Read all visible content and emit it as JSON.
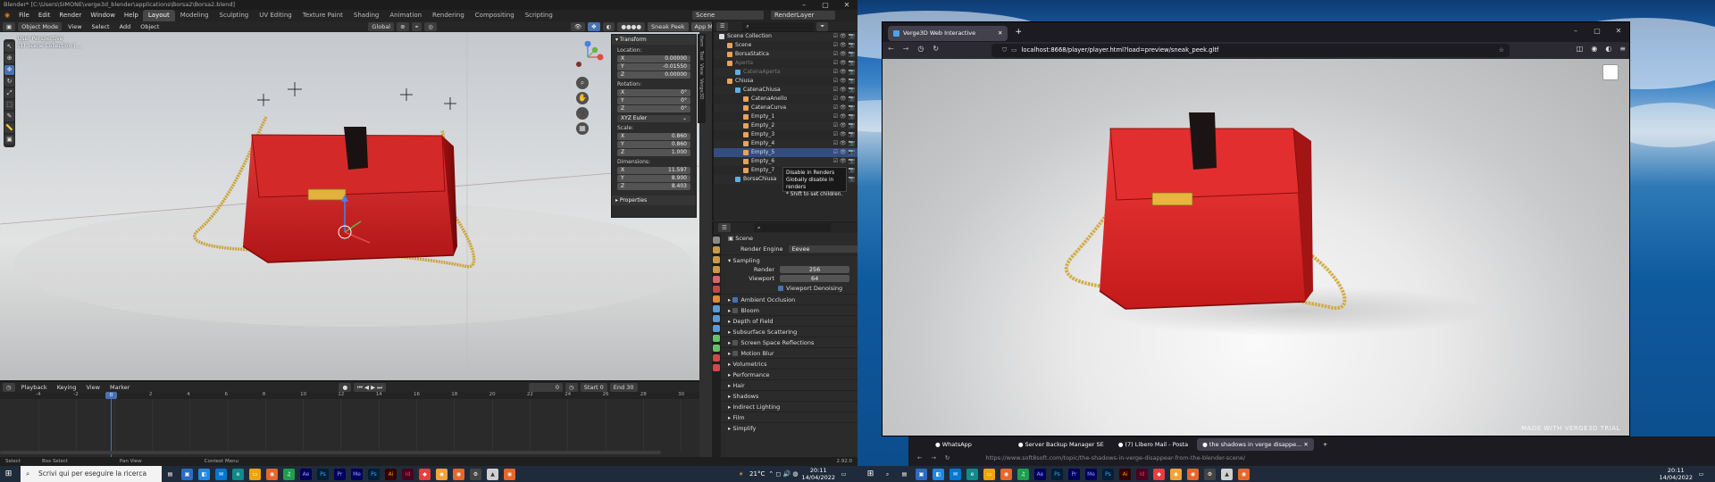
{
  "blender": {
    "title": "Blender* [C:\\Users\\SIMONE\\verge3d_blender\\applications\\Borsa2\\Borsa2.blend]",
    "menus": [
      "File",
      "Edit",
      "Render",
      "Window",
      "Help"
    ],
    "workspaces": [
      "Layout",
      "Modeling",
      "Sculpting",
      "UV Editing",
      "Texture Paint",
      "Shading",
      "Animation",
      "Rendering",
      "Compositing",
      "Scripting"
    ],
    "active_workspace": "Layout",
    "scene": "Scene",
    "view_layer": "RenderLayer",
    "vp_header": {
      "mode": "Object Mode",
      "view": "View",
      "select": "Select",
      "add": "Add",
      "object": "Object",
      "orientation": "Global",
      "sneak_peek": "Sneak Peek",
      "app_manager": "App Manager"
    },
    "viewport_info": [
      "User Perspective",
      "(1) Scene Collection | ..."
    ],
    "npanel": {
      "transform": "Transform",
      "location_label": "Location:",
      "location": [
        {
          "axis": "X",
          "value": "0.00000"
        },
        {
          "axis": "Y",
          "value": "-0.01550"
        },
        {
          "axis": "Z",
          "value": "0.00000"
        }
      ],
      "rotation_label": "Rotation:",
      "rotation": [
        {
          "axis": "X",
          "value": "0°"
        },
        {
          "axis": "Y",
          "value": "0°"
        },
        {
          "axis": "Z",
          "value": "0°"
        }
      ],
      "rotation_mode": "XYZ Euler",
      "scale_label": "Scale:",
      "scale": [
        {
          "axis": "X",
          "value": "0.860"
        },
        {
          "axis": "Y",
          "value": "0.860"
        },
        {
          "axis": "Z",
          "value": "1.000"
        }
      ],
      "dimensions_label": "Dimensions:",
      "dimensions": [
        {
          "axis": "X",
          "value": "11.597"
        },
        {
          "axis": "Y",
          "value": "8.900"
        },
        {
          "axis": "Z",
          "value": "8.403"
        }
      ],
      "properties": "Properties",
      "tabs": [
        "Item",
        "Tool",
        "View",
        "Verge3D",
        "Edit"
      ]
    },
    "outliner": {
      "rows": [
        {
          "name": "Scene Collection",
          "indent": 0,
          "cls": ""
        },
        {
          "name": "Scene",
          "indent": 1,
          "cls": ""
        },
        {
          "name": "BorsaStatica",
          "indent": 1,
          "cls": ""
        },
        {
          "name": "Aperta",
          "indent": 1,
          "cls": "dim"
        },
        {
          "name": "CatenaAperta",
          "indent": 2,
          "cls": "dim"
        },
        {
          "name": "Chiusa",
          "indent": 1,
          "cls": ""
        },
        {
          "name": "CatenaChiusa",
          "indent": 2,
          "cls": ""
        },
        {
          "name": "CatenaAnello",
          "indent": 3,
          "cls": ""
        },
        {
          "name": "CatenaCurva",
          "indent": 3,
          "cls": ""
        },
        {
          "name": "Empty_1",
          "indent": 3,
          "cls": ""
        },
        {
          "name": "Empty_2",
          "indent": 3,
          "cls": ""
        },
        {
          "name": "Empty_3",
          "indent": 3,
          "cls": ""
        },
        {
          "name": "Empty_4",
          "indent": 3,
          "cls": ""
        },
        {
          "name": "Empty_5",
          "indent": 3,
          "cls": "sel"
        },
        {
          "name": "Empty_6",
          "indent": 3,
          "cls": ""
        },
        {
          "name": "Empty_7",
          "indent": 3,
          "cls": ""
        },
        {
          "name": "BorsaChiusa",
          "indent": 2,
          "cls": ""
        }
      ],
      "tooltip": [
        "Disable in Renders",
        "Globally disable in renders",
        "* Shift to set children."
      ]
    },
    "properties": {
      "scene": "Scene",
      "render_engine_label": "Render Engine",
      "render_engine": "Eevee",
      "sampling": "Sampling",
      "render_label": "Render",
      "render_val": "256",
      "viewport_label": "Viewport",
      "viewport_val": "64",
      "denoise": "Viewport Denoising",
      "sections": [
        {
          "label": "Ambient Occlusion",
          "check": true
        },
        {
          "label": "Bloom",
          "check": false
        },
        {
          "label": "Depth of Field",
          "check": null
        },
        {
          "label": "Subsurface Scattering",
          "check": null
        },
        {
          "label": "Screen Space Reflections",
          "check": false
        },
        {
          "label": "Motion Blur",
          "check": false
        },
        {
          "label": "Volumetrics",
          "check": null
        },
        {
          "label": "Performance",
          "check": null
        },
        {
          "label": "Hair",
          "check": null
        },
        {
          "label": "Shadows",
          "check": null
        },
        {
          "label": "Indirect Lighting",
          "check": null
        },
        {
          "label": "Film",
          "check": null
        },
        {
          "label": "Simplify",
          "check": null
        }
      ]
    },
    "timeline": {
      "menus": [
        "Playback",
        "Keying",
        "View",
        "Marker"
      ],
      "current_frame": "0",
      "start_label": "Start",
      "start": "0",
      "end_label": "End",
      "end": "30",
      "ticks": [
        "-4",
        "-2",
        "0",
        "2",
        "4",
        "6",
        "8",
        "10",
        "12",
        "14",
        "16",
        "18",
        "20",
        "22",
        "24",
        "26",
        "28",
        "30"
      ]
    },
    "status": {
      "select": "Select",
      "box_select": "Box Select",
      "pan_view": "Pan View",
      "context_menu": "Context Menu",
      "version": "2.92.0"
    }
  },
  "browser": {
    "tab_title": "Verge3D Web Interactive",
    "url": "localhost:8668/player/player.html?load=preview/sneak_peek.gltf",
    "watermark": "MADE WITH VERGE3D TRIAL"
  },
  "browser2": {
    "tabs": [
      "WhatsApp",
      "Server Backup Manager SE",
      "(7) Libero Mail - Posta",
      "the shadows in verge disappe..."
    ],
    "url": "https://www.soft8soft.com/topic/the-shadows-in-verge-disappear-from-the-blender-scene/"
  },
  "taskbar": {
    "search_placeholder": "Scrivi qui per eseguire la ricerca",
    "temperature": "21°C",
    "time": "20:11",
    "date": "14/04/2022"
  }
}
